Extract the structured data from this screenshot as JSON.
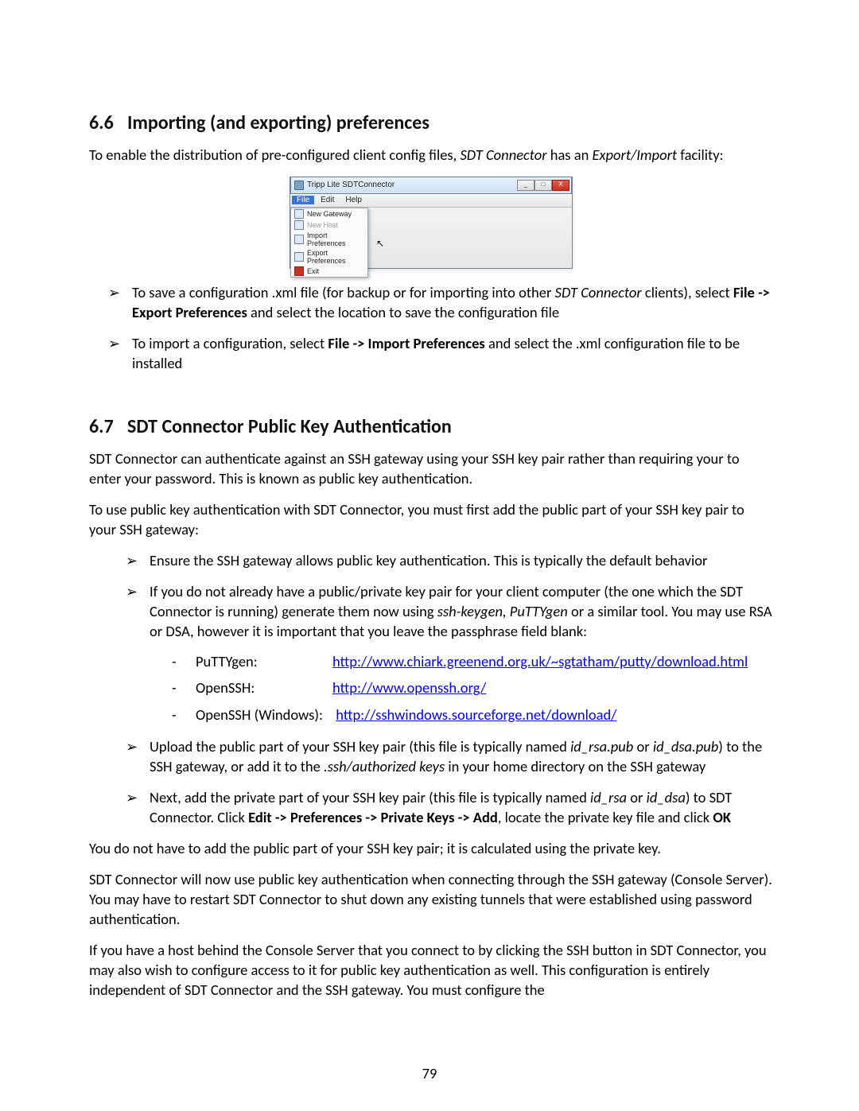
{
  "section66": {
    "num": "6.6",
    "title": "Importing (and exporting) preferences",
    "intro_pre": "To enable the distribution of pre-configured client config files, ",
    "intro_em1": "SDT Connector",
    "intro_mid": " has an ",
    "intro_em2": "Export/Import",
    "intro_post": " facility:"
  },
  "screenshot": {
    "title": "Tripp Lite SDTConnector",
    "menu": {
      "file": "File",
      "edit": "Edit",
      "help": "Help"
    },
    "items": {
      "new_gateway": "New Gateway",
      "new_host": "New Host",
      "import_prefs": "Import Preferences",
      "export_prefs": "Export Preferences",
      "exit": "Exit"
    },
    "win_buttons": {
      "min": "_",
      "max": "□",
      "close": "X"
    },
    "cursor": "⮡"
  },
  "bullets66": {
    "b1_pre": "To save a configuration .xml file (for backup or for importing into other ",
    "b1_em": "SDT Connector",
    "b1_mid": " clients), select ",
    "b1_bold": "File -> Export Preferences",
    "b1_post": " and select the location to save the configuration file",
    "b2_pre": "To import a configuration, select ",
    "b2_bold": "File -> Import Preferences",
    "b2_post": " and select the .xml configuration file to be installed"
  },
  "section67": {
    "num": "6.7",
    "title": "SDT Connector Public Key Authentication",
    "p1": "SDT Connector can authenticate against an SSH gateway using your SSH key pair rather than requiring your to enter your password. This is known as public key authentication.",
    "p2": "To use public key authentication with SDT Connector, you must first add the public part of your SSH key pair to your SSH gateway:"
  },
  "bullets67": {
    "b1": "Ensure the SSH gateway allows public key authentication. This is typically the default behavior",
    "b2_pre": "If you do not already have a public/private key pair for your client computer (the one which the SDT Connector is running) generate them now using ",
    "b2_em": "ssh-keygen, PuTTYgen",
    "b2_post": " or a similar tool. You may use RSA or DSA, however it is important that you leave the passphrase field blank:",
    "links": {
      "l1_label": "PuTTYgen:",
      "l1_url": "http://www.chiark.greenend.org.uk/~sgtatham/putty/download.html",
      "l2_label": "OpenSSH:",
      "l2_url": "http://www.openssh.org/",
      "l3_label": "OpenSSH (Windows):",
      "l3_url": "http://sshwindows.sourceforge.net/download/"
    },
    "b3_pre": "Upload the public part of your SSH key pair (this file is typically named ",
    "b3_em1": "id_rsa.pub",
    "b3_mid1": " or ",
    "b3_em2": "id_dsa.pub",
    "b3_mid2": ") to the SSH gateway, or add it to the ",
    "b3_em3": ".ssh/authorized keys",
    "b3_post": " in your home directory on the SSH gateway",
    "b4_pre": "Next, add the private part of your SSH key pair (this file is typically named ",
    "b4_em1": "id_rsa",
    "b4_mid1": " or ",
    "b4_em2": "id_dsa",
    "b4_mid2": ") to SDT Connector. Click ",
    "b4_bold": "Edit -> Preferences -> Private Keys -> Add",
    "b4_mid3": ", locate the private key file and click ",
    "b4_bold2": "OK"
  },
  "post67": {
    "p1": "You do not have to add the public part of your SSH key pair; it is calculated using the private key.",
    "p2": "SDT Connector will now use public key authentication when connecting through the SSH gateway (Console Server). You may have to restart SDT Connector to shut down any existing tunnels that were established using password authentication.",
    "p3": "If you have a host behind the Console Server that you connect to by clicking the SSH button in SDT Connector, you may also wish to configure access to it for public key authentication as well. This configuration is entirely independent of SDT Connector and the SSH gateway. You must configure the"
  },
  "page_number": "79"
}
